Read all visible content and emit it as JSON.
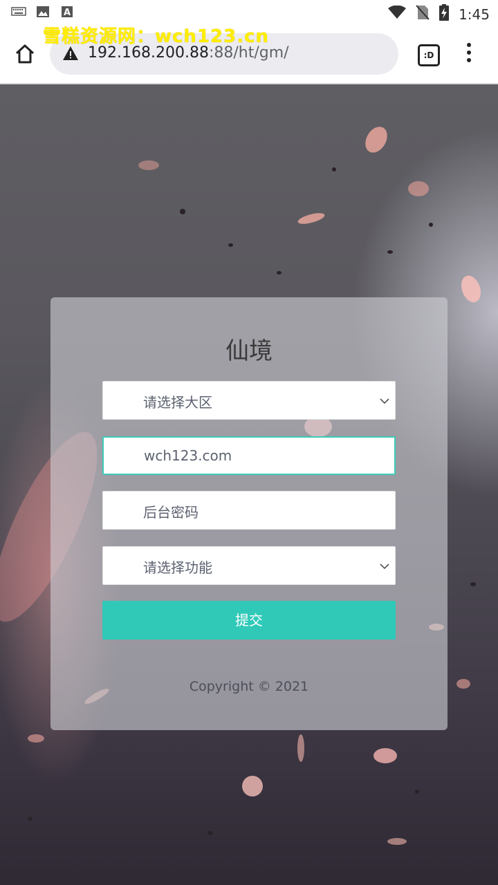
{
  "status_bar": {
    "time": "1:45",
    "icons": [
      "keyboard-icon",
      "image-icon",
      "font-icon",
      "wifi-icon",
      "no-sim-icon",
      "battery-charging-icon"
    ]
  },
  "watermark": "雪糕资源网：wch123.cn",
  "browser": {
    "url_host": "192.168.200.88",
    "url_path": ":88/ht/gm/",
    "tab_count_label": ":D"
  },
  "form": {
    "title": "仙境",
    "region_select": {
      "value": "请选择大区"
    },
    "account_input": {
      "value": "wch123.com"
    },
    "password_input": {
      "placeholder": "后台密码"
    },
    "function_select": {
      "value": "请选择功能"
    },
    "submit_label": "提交",
    "copyright": "Copyright © 2021"
  },
  "colors": {
    "accent": "#30c9b8",
    "watermark": "#ffee00"
  }
}
